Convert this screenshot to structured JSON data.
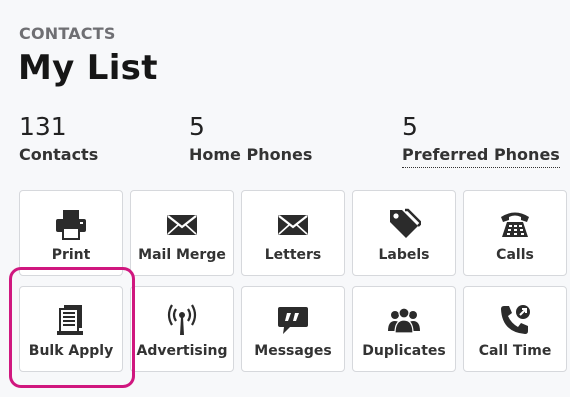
{
  "header": {
    "section": "CONTACTS",
    "title": "My List"
  },
  "stats": [
    {
      "value": "131",
      "label": "Contacts"
    },
    {
      "value": "5",
      "label": "Home Phones"
    },
    {
      "value": "5",
      "label": "Preferred Phones"
    }
  ],
  "actions": [
    {
      "label": "Print",
      "icon": "printer-icon"
    },
    {
      "label": "Mail Merge",
      "icon": "envelope-icon"
    },
    {
      "label": "Letters",
      "icon": "envelope-icon"
    },
    {
      "label": "Labels",
      "icon": "tags-icon"
    },
    {
      "label": "Calls",
      "icon": "desk-phone-icon"
    },
    {
      "label": "Bulk Apply",
      "icon": "stack-icon"
    },
    {
      "label": "Advertising",
      "icon": "broadcast-tower-icon"
    },
    {
      "label": "Messages",
      "icon": "chat-quote-icon"
    },
    {
      "label": "Duplicates",
      "icon": "users-group-icon"
    },
    {
      "label": "Call Time",
      "icon": "phone-outgoing-icon"
    }
  ],
  "highlight_color": "#d0177f",
  "icon_color": "#2b2b2b"
}
